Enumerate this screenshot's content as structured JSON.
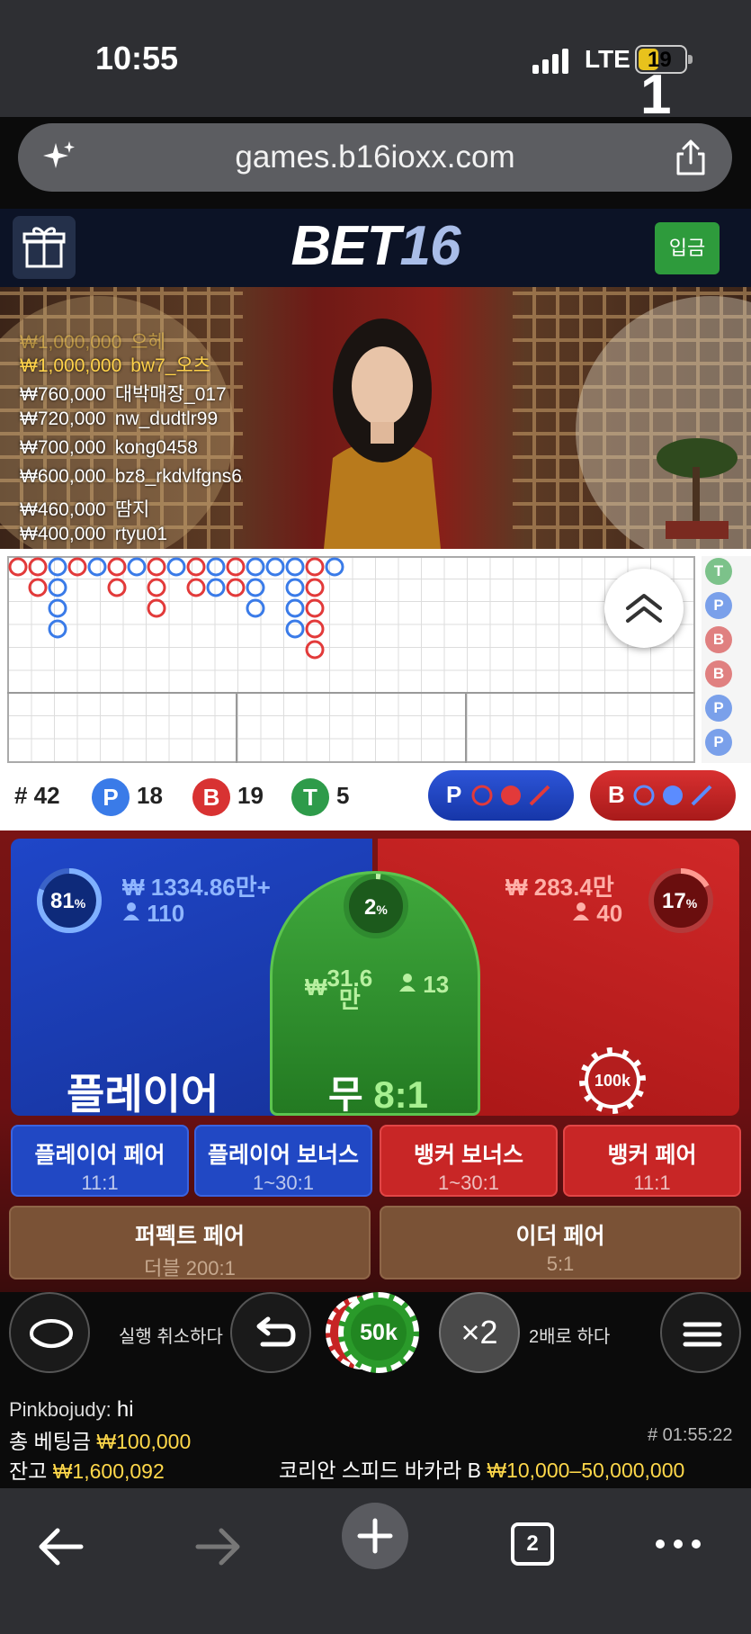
{
  "status": {
    "time": "10:55",
    "network": "LTE",
    "battery": "19"
  },
  "browser": {
    "url": "games.b16ioxx.com",
    "tab_count": "2"
  },
  "header": {
    "logo_white": "BET",
    "logo_blue": "16",
    "deposit_label": "입금"
  },
  "video": {
    "round": "1",
    "leaderboard": [
      {
        "amount": "₩1,000,000",
        "name": "bw7_오츠"
      },
      {
        "amount": "₩760,000",
        "name": "대박매장_017"
      },
      {
        "amount": "₩720,000",
        "name": "nw_dudtlr99"
      },
      {
        "amount": "₩700,000",
        "name": "kong0458"
      },
      {
        "amount": "₩600,000",
        "name": "bz8_rkdvlfgns6"
      },
      {
        "amount": "₩460,000",
        "name": "땀지"
      },
      {
        "amount": "₩400,000",
        "name": "rtyu01"
      }
    ],
    "leaderboard_faded": {
      "amount": "₩1,000,000",
      "name": "으헤"
    }
  },
  "road_side": [
    "T",
    "P",
    "B",
    "B",
    "P",
    "P"
  ],
  "stats": {
    "total_label": "# 42",
    "player_count": "18",
    "banker_count": "19",
    "tie_count": "5",
    "p": "P",
    "b": "B",
    "t": "T"
  },
  "predict": {
    "player": "P",
    "banker": "B"
  },
  "bets": {
    "player": {
      "pct": "81",
      "pct_sign": "%",
      "amount": "₩ 1334.86만+",
      "users": "110",
      "label": "플레이어"
    },
    "banker": {
      "pct": "17",
      "pct_sign": "%",
      "amount": "₩ 283.4만",
      "users": "40",
      "chip": "100k"
    },
    "tie": {
      "pct": "2",
      "pct_sign": "%",
      "amount_cur": "₩",
      "amount": "31.6",
      "amount_unit": "만",
      "users": "13",
      "label": "무",
      "odds": "8:1"
    },
    "side": [
      {
        "title": "플레이어 페어",
        "odds": "11:1"
      },
      {
        "title": "플레이어 보너스",
        "odds": "1~30:1"
      },
      {
        "title": "뱅커 보너스",
        "odds": "1~30:1"
      },
      {
        "title": "뱅커 페어",
        "odds": "11:1"
      }
    ],
    "perfect": {
      "title": "퍼펙트 페어",
      "odds": "더블 200:1"
    },
    "either": {
      "title": "이더 페어",
      "odds": "5:1"
    }
  },
  "controls": {
    "undo_label": "실행 취소하다",
    "chip": "50k",
    "double_icon": "×2",
    "double_label": "2배로 하다"
  },
  "footer": {
    "chat_user": "Pinkbojudy:",
    "chat_msg": "hi",
    "total_label": "총 베팅금",
    "total_value": "₩100,000",
    "balance_label": "잔고",
    "balance_value": "₩1,600,092",
    "round_id": "# 01:55:22",
    "table_name": "코리안 스피드 바카라 B",
    "limits": "₩10,000–50,000,000"
  },
  "colors": {
    "player": "#2148c4",
    "banker": "#c82626",
    "tie": "#2e9b3c",
    "gold": "#ffd84a"
  }
}
